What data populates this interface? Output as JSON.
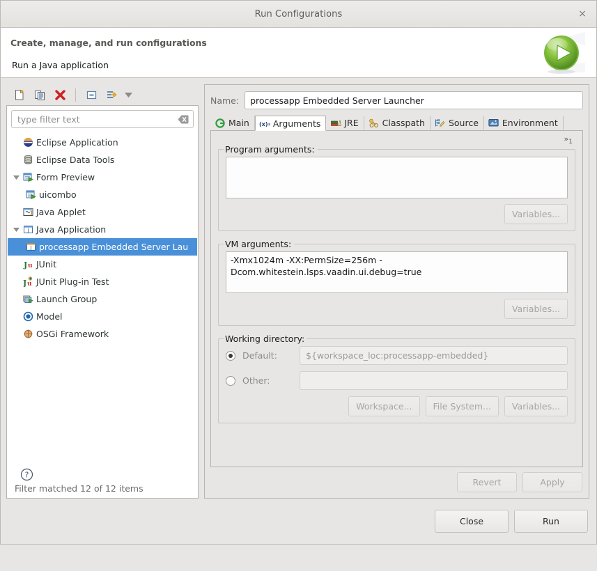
{
  "window": {
    "title": "Run Configurations",
    "close_label": "×"
  },
  "header": {
    "title": "Create, manage, and run configurations",
    "subtitle": "Run a Java application",
    "icon": "run-launch-icon"
  },
  "left_toolbar": {
    "buttons": [
      {
        "name": "new-launch-configuration",
        "icon": "new-document-icon"
      },
      {
        "name": "duplicate-launch-configuration",
        "icon": "copy-icon"
      },
      {
        "name": "delete-launch-configuration",
        "icon": "delete-x-icon"
      },
      {
        "name": "collapse-all",
        "icon": "collapse-all-icon"
      },
      {
        "name": "filter-launch-configurations",
        "icon": "filter-icon"
      },
      {
        "name": "view-menu",
        "icon": "chevron-down-icon"
      }
    ]
  },
  "filter": {
    "placeholder": "type filter text",
    "value": "",
    "clear_icon": "clear-backspace-icon",
    "status": "Filter matched 12 of 12 items"
  },
  "tree": {
    "items": [
      {
        "label": "Eclipse Application",
        "icon": "eclipse-icon",
        "depth": 0,
        "twisty": "none",
        "selected": false
      },
      {
        "label": "Eclipse Data Tools",
        "icon": "database-icon",
        "depth": 0,
        "twisty": "none",
        "selected": false
      },
      {
        "label": "Form Preview",
        "icon": "form-preview-icon",
        "depth": 0,
        "twisty": "expanded",
        "selected": false
      },
      {
        "label": "uicombo",
        "icon": "form-preview-icon",
        "depth": 1,
        "twisty": "none",
        "selected": false
      },
      {
        "label": "Java Applet",
        "icon": "java-applet-icon",
        "depth": 0,
        "twisty": "none",
        "selected": false
      },
      {
        "label": "Java Application",
        "icon": "java-application-icon",
        "depth": 0,
        "twisty": "expanded",
        "selected": false
      },
      {
        "label": "processapp Embedded Server Lau",
        "icon": "java-application-icon",
        "depth": 1,
        "twisty": "none",
        "selected": true
      },
      {
        "label": "JUnit",
        "icon": "junit-icon",
        "depth": 0,
        "twisty": "none",
        "selected": false
      },
      {
        "label": "JUnit Plug-in Test",
        "icon": "junit-plugin-icon",
        "depth": 0,
        "twisty": "none",
        "selected": false
      },
      {
        "label": "Launch Group",
        "icon": "launch-group-icon",
        "depth": 0,
        "twisty": "none",
        "selected": false
      },
      {
        "label": "Model",
        "icon": "model-icon",
        "depth": 0,
        "twisty": "none",
        "selected": false
      },
      {
        "label": "OSGi Framework",
        "icon": "osgi-icon",
        "depth": 0,
        "twisty": "none",
        "selected": false
      }
    ]
  },
  "help": {
    "icon": "help-question-icon"
  },
  "config": {
    "name_label": "Name:",
    "name_value": "processapp Embedded Server Launcher",
    "tabs": [
      {
        "label": "Main",
        "icon": "main-tab-icon",
        "active": false
      },
      {
        "label": "Arguments",
        "icon": "arguments-tab-icon",
        "active": true
      },
      {
        "label": "JRE",
        "icon": "jre-tab-icon",
        "active": false
      },
      {
        "label": "Classpath",
        "icon": "classpath-tab-icon",
        "active": false
      },
      {
        "label": "Source",
        "icon": "source-tab-icon",
        "active": false
      },
      {
        "label": "Environment",
        "icon": "environment-tab-icon",
        "active": false
      }
    ],
    "tab_overflow": {
      "symbol": "»",
      "count": "1"
    },
    "program_arguments": {
      "title": "Program arguments:",
      "value": "",
      "variables_button": "Variables...",
      "variables_enabled": false
    },
    "vm_arguments": {
      "title": "VM arguments:",
      "value": "-Xmx1024m -XX:PermSize=256m -Dcom.whitestein.lsps.vaadin.ui.debug=true",
      "variables_button": "Variables...",
      "variables_enabled": false
    },
    "working_directory": {
      "title": "Working directory:",
      "default_label": "Default:",
      "default_selected": true,
      "default_value": "${workspace_loc:processapp-embedded}",
      "other_label": "Other:",
      "other_selected": false,
      "other_value": "",
      "buttons": [
        {
          "label": "Workspace...",
          "enabled": false
        },
        {
          "label": "File System...",
          "enabled": false
        },
        {
          "label": "Variables...",
          "enabled": false
        }
      ]
    },
    "revert_button": {
      "label": "Revert",
      "enabled": false
    },
    "apply_button": {
      "label": "Apply",
      "enabled": false
    }
  },
  "footer": {
    "close_button": "Close",
    "run_button": "Run"
  },
  "colors": {
    "selection_blue": "#4a90d9",
    "dialog_background": "#e7e6e4",
    "field_background": "#ffffff",
    "run_green": "#6ab04c",
    "delete_red": "#cc2222"
  }
}
